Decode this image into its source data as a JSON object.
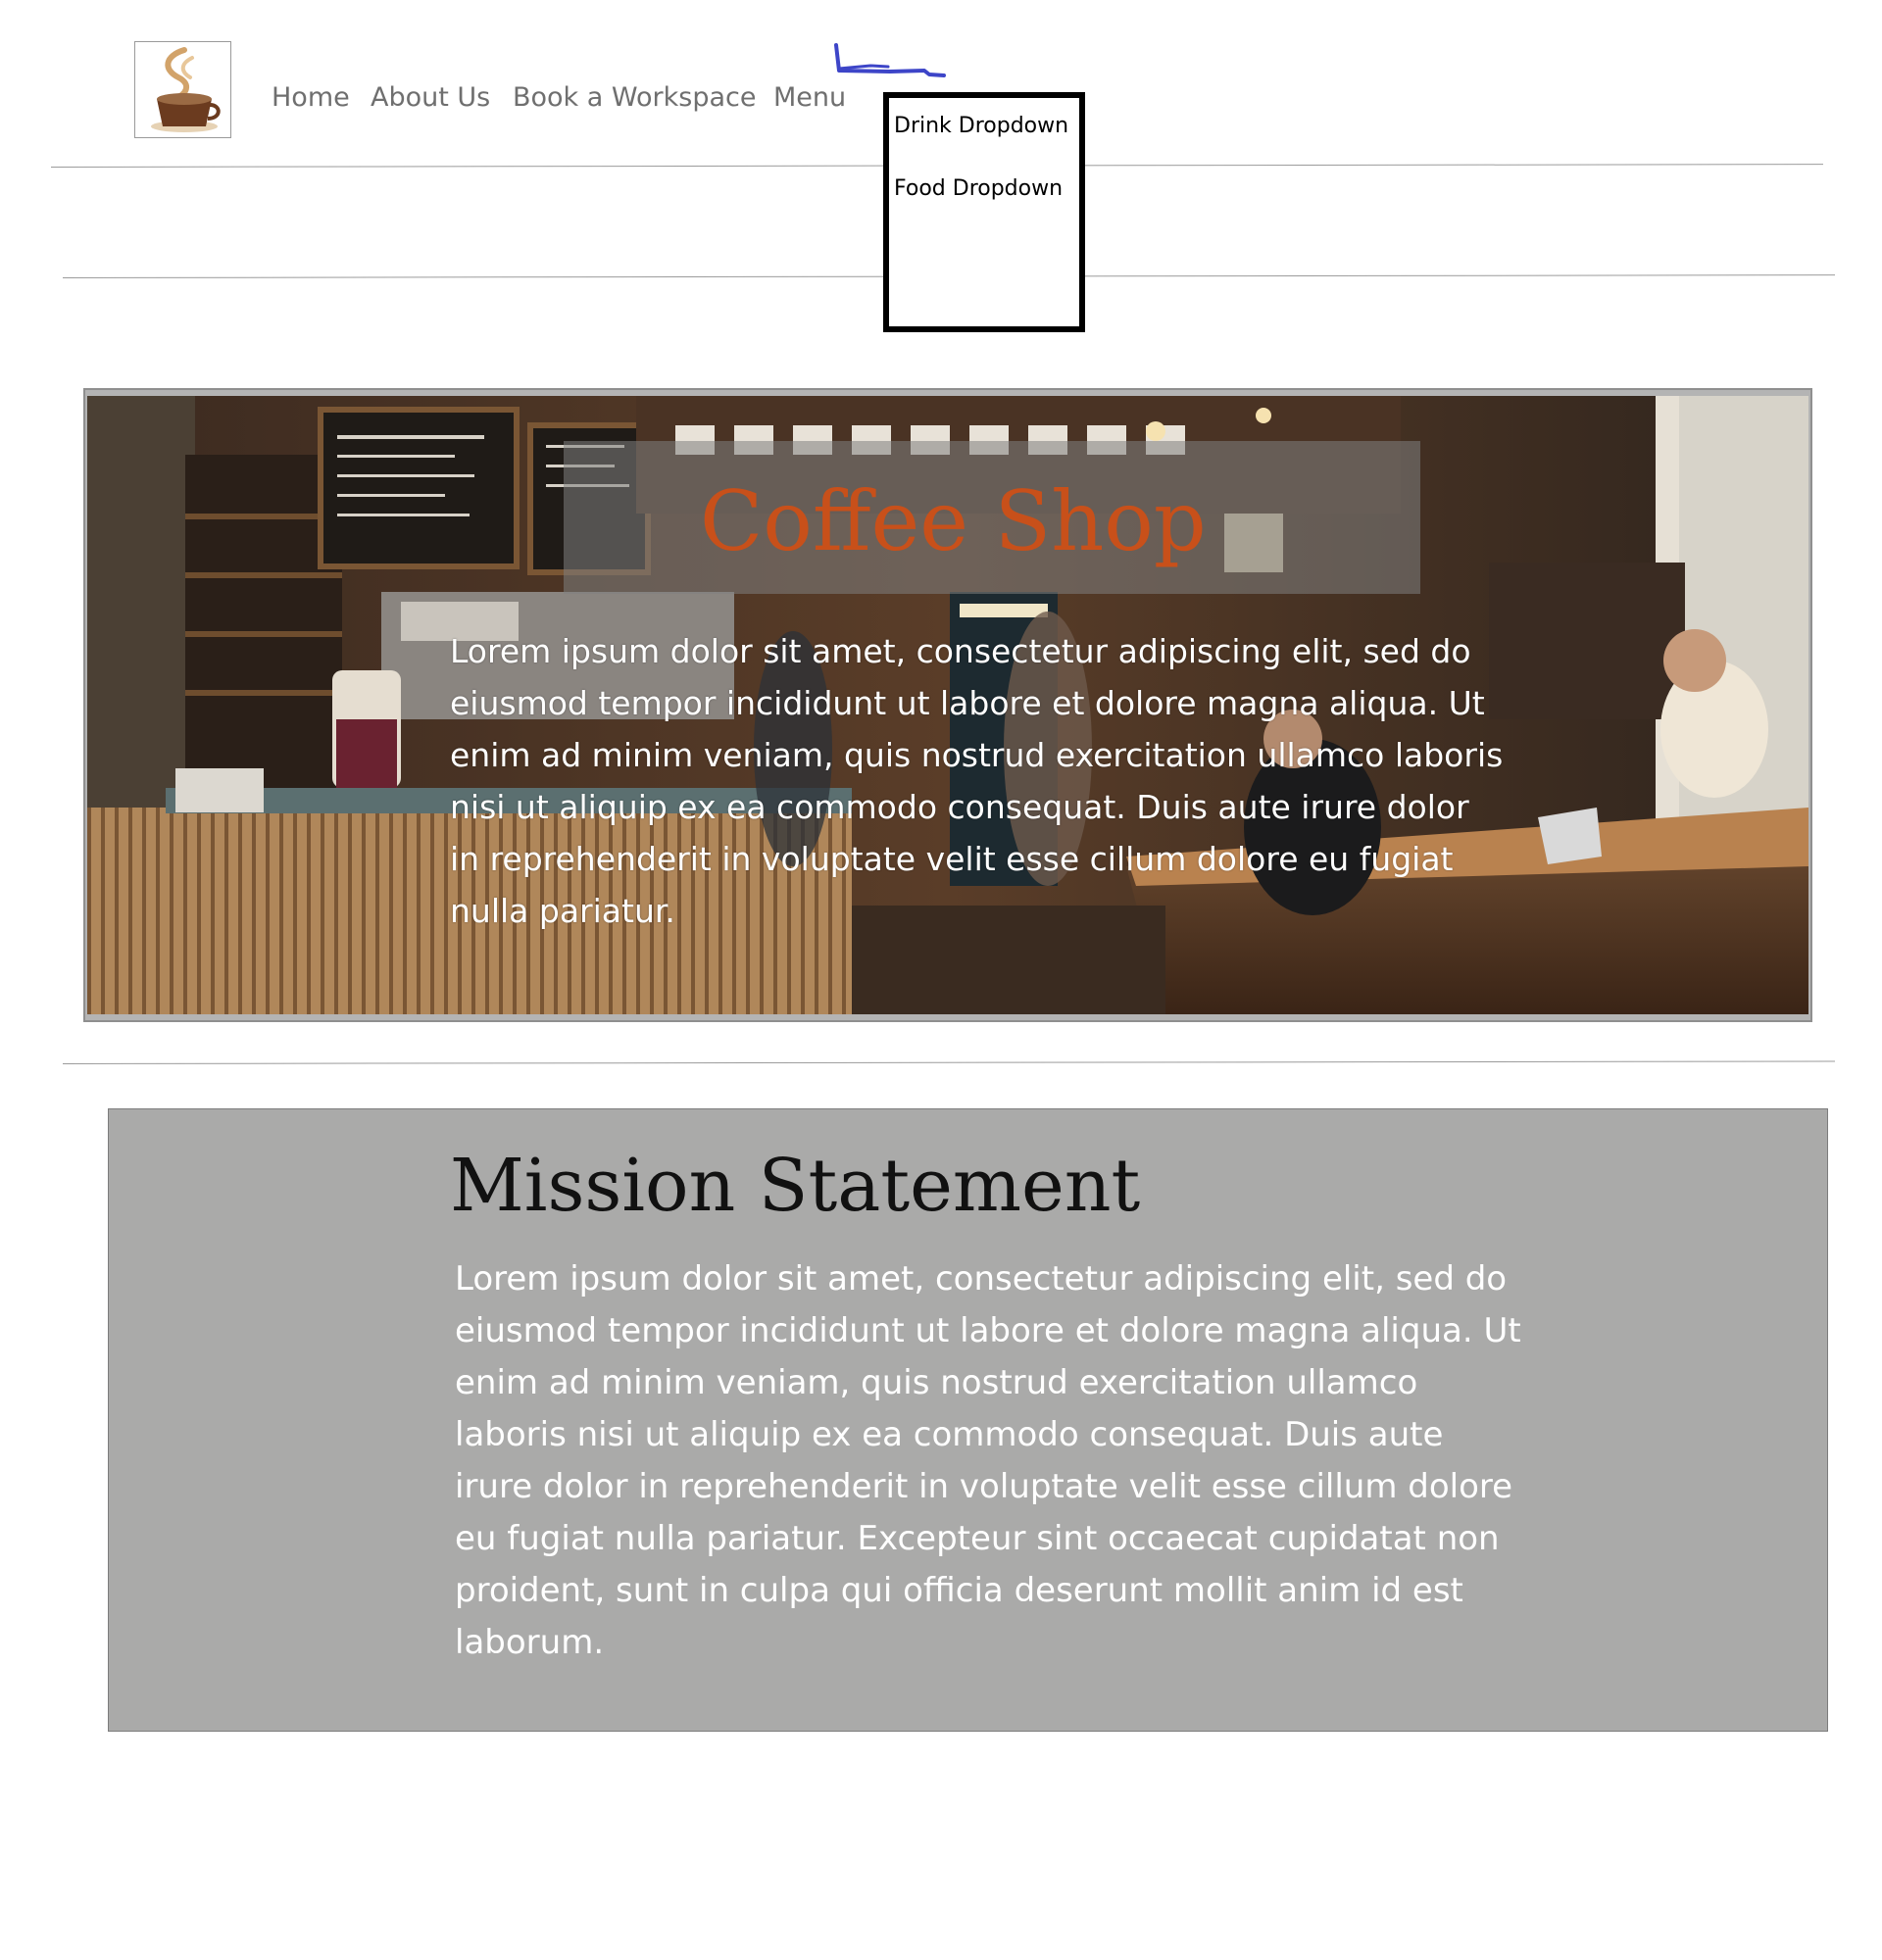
{
  "nav": {
    "items": [
      {
        "label": "Home"
      },
      {
        "label": "About Us"
      },
      {
        "label": "Book a Workspace"
      },
      {
        "label": "Menu"
      }
    ]
  },
  "dropdown": {
    "items": [
      {
        "label": "Drink Dropdown"
      },
      {
        "label": "Food Dropdown"
      }
    ]
  },
  "hero": {
    "title": "Coffee Shop",
    "text": "Lorem ipsum dolor sit amet, consectetur adipiscing elit, sed do eiusmod tempor incididunt ut labore et dolore magna aliqua. Ut enim ad minim veniam, quis nostrud exercitation ullamco laboris nisi ut aliquip ex ea commodo consequat. Duis aute irure dolor in reprehenderit in voluptate velit esse cillum dolore eu fugiat nulla pariatur."
  },
  "mission": {
    "title": "Mission Statement",
    "text": "Lorem ipsum dolor sit amet, consectetur adipiscing elit, sed do eiusmod tempor incididunt ut labore et dolore magna aliqua. Ut enim ad minim veniam, quis nostrud exercitation ullamco laboris nisi ut aliquip ex ea commodo consequat. Duis aute irure dolor in reprehenderit in voluptate velit esse cillum dolore eu fugiat nulla pariatur. Excepteur sint occaecat cupidatat non proident, sunt in culpa qui officia deserunt mollit anim id est laborum."
  },
  "colors": {
    "title_accent": "#c8501a",
    "mission_panel": "#aaaaa9",
    "dropdown_border": "#000000",
    "scribble": "#3d45c8"
  },
  "icons": {
    "logo": "coffee-cup-logo",
    "scribble": "pen-scribble"
  }
}
